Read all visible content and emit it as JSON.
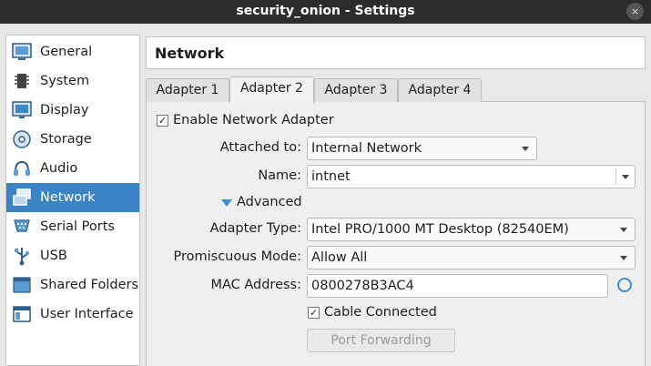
{
  "window": {
    "title": "security_onion - Settings",
    "close_glyph": "×"
  },
  "sidebar": {
    "items": [
      {
        "label": "General",
        "icon": "general-icon"
      },
      {
        "label": "System",
        "icon": "system-icon"
      },
      {
        "label": "Display",
        "icon": "display-icon"
      },
      {
        "label": "Storage",
        "icon": "storage-icon"
      },
      {
        "label": "Audio",
        "icon": "audio-icon"
      },
      {
        "label": "Network",
        "icon": "network-icon",
        "active": true
      },
      {
        "label": "Serial Ports",
        "icon": "serial-ports-icon"
      },
      {
        "label": "USB",
        "icon": "usb-icon"
      },
      {
        "label": "Shared Folders",
        "icon": "shared-folders-icon"
      },
      {
        "label": "User Interface",
        "icon": "user-interface-icon"
      }
    ]
  },
  "page": {
    "title": "Network"
  },
  "tabs": [
    {
      "label": "Adapter 1"
    },
    {
      "label": "Adapter 2",
      "active": true
    },
    {
      "label": "Adapter 3"
    },
    {
      "label": "Adapter 4"
    }
  ],
  "adapter": {
    "enable_label": "Enable Network Adapter",
    "enable_checked": true,
    "check_glyph": "✓",
    "attached_label": "Attached to:",
    "attached_value": "Internal Network",
    "name_label": "Name:",
    "name_value": "intnet",
    "advanced_label": "Advanced",
    "adapter_type_label": "Adapter Type:",
    "adapter_type_value": "Intel PRO/1000 MT Desktop (82540EM)",
    "promiscuous_label": "Promiscuous Mode:",
    "promiscuous_value": "Allow All",
    "mac_label": "MAC Address:",
    "mac_value": "0800278B3AC4",
    "cable_label": "Cable Connected",
    "cable_checked": true,
    "port_forwarding_label": "Port Forwarding"
  },
  "colors": {
    "accent": "#3a84c6",
    "titlebar": "#2c2c2c"
  }
}
